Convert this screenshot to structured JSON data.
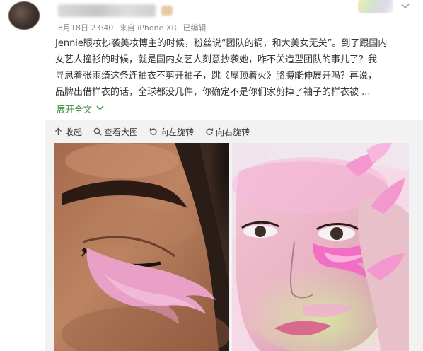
{
  "post": {
    "timestamp": "8月18日 23:40",
    "source": "来自 iPhone XR",
    "edited": "已编辑",
    "lines": [
      "Jennie眼妆抄袭美妆博主的时候，粉丝说“团队的锅，和大美女无关”。到了跟国内",
      "女艺人撞衫的时候，就是国内女艺人刻意抄袭她，咋不关造型团队的事儿了？我",
      "寻思着张雨绮这条连袖衣不剪开袖子，跳《屋顶着火》胳膊能伸展开吗？再说，",
      "品牌出借样衣的话，全球都没几件，你确定不是你们家剪掉了袖子的样衣被 ..."
    ],
    "expand_label": "展开全文",
    "expand_icon": "chevron-down-icon"
  },
  "toolbar": {
    "collapse_label": "收起",
    "collapse_icon": "arrow-up-icon",
    "view_large_label": "查看大图",
    "view_large_icon": "magnifier-icon",
    "rotate_left_label": "向左旋转",
    "rotate_left_icon": "rotate-left-icon",
    "rotate_right_label": "向右旋转",
    "rotate_right_icon": "rotate-right-icon"
  },
  "images": {
    "left_icon": "eye-makeup-photo",
    "right_icon": "face-makeup-photo"
  },
  "colors": {
    "link_green": "#3a8f3a",
    "text": "#333333",
    "meta_gray": "#888888",
    "media_bg": "#f2f2f2",
    "makeup_pink": "#ec8fc4"
  }
}
